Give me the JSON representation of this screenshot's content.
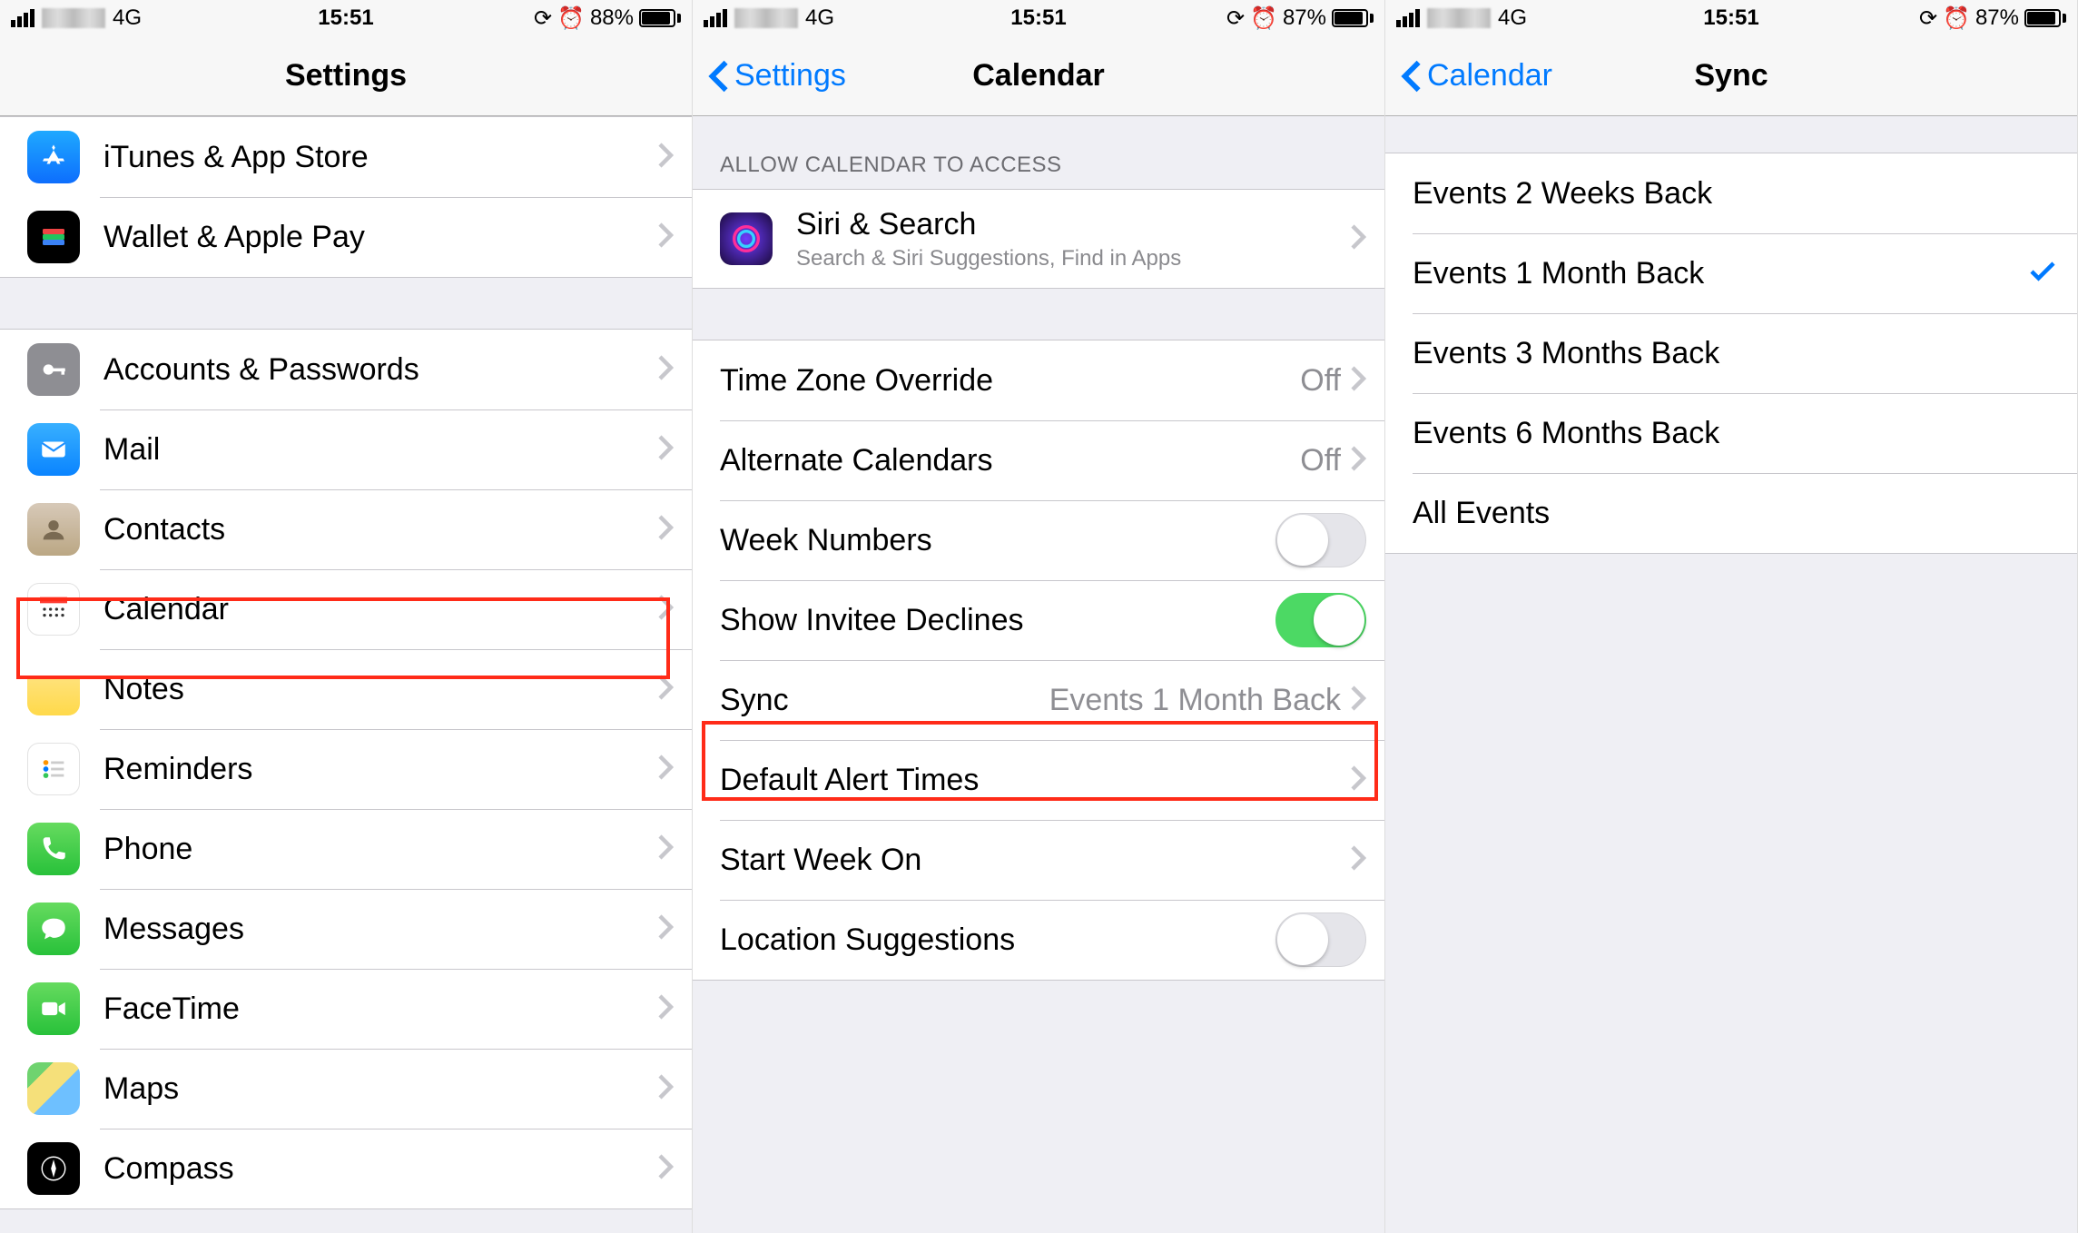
{
  "panes": {
    "left": {
      "status": {
        "network": "4G",
        "time": "15:51",
        "battery": "88%"
      },
      "nav": {
        "title": "Settings"
      },
      "group1": [
        {
          "icon": "appstore",
          "label": "iTunes & App Store"
        },
        {
          "icon": "wallet",
          "label": "Wallet & Apple Pay"
        }
      ],
      "group2": [
        {
          "icon": "accounts",
          "label": "Accounts & Passwords"
        },
        {
          "icon": "mail",
          "label": "Mail"
        },
        {
          "icon": "contacts",
          "label": "Contacts"
        },
        {
          "icon": "calendar",
          "label": "Calendar",
          "highlighted": true
        },
        {
          "icon": "notes",
          "label": "Notes"
        },
        {
          "icon": "reminders",
          "label": "Reminders"
        },
        {
          "icon": "phone",
          "label": "Phone"
        },
        {
          "icon": "messages",
          "label": "Messages"
        },
        {
          "icon": "facetime",
          "label": "FaceTime"
        },
        {
          "icon": "maps",
          "label": "Maps"
        },
        {
          "icon": "compass",
          "label": "Compass"
        }
      ]
    },
    "middle": {
      "status": {
        "network": "4G",
        "time": "15:51",
        "battery": "87%"
      },
      "nav": {
        "back": "Settings",
        "title": "Calendar"
      },
      "section_header": "ALLOW CALENDAR TO ACCESS",
      "siri": {
        "label": "Siri & Search",
        "sub": "Search & Siri Suggestions, Find in Apps"
      },
      "rows": {
        "timezone": {
          "label": "Time Zone Override",
          "value": "Off"
        },
        "altcal": {
          "label": "Alternate Calendars",
          "value": "Off"
        },
        "weeknum": {
          "label": "Week Numbers",
          "toggle": false
        },
        "declines": {
          "label": "Show Invitee Declines",
          "toggle": true
        },
        "sync": {
          "label": "Sync",
          "value": "Events 1 Month Back",
          "highlighted": true
        },
        "alerts": {
          "label": "Default Alert Times"
        },
        "startweek": {
          "label": "Start Week On"
        },
        "location": {
          "label": "Location Suggestions",
          "toggle": false
        }
      }
    },
    "right": {
      "status": {
        "network": "4G",
        "time": "15:51",
        "battery": "87%"
      },
      "nav": {
        "back": "Calendar",
        "title": "Sync"
      },
      "options": [
        {
          "label": "Events 2 Weeks Back",
          "checked": false
        },
        {
          "label": "Events 1 Month Back",
          "checked": true
        },
        {
          "label": "Events 3 Months Back",
          "checked": false
        },
        {
          "label": "Events 6 Months Back",
          "checked": false
        },
        {
          "label": "All Events",
          "checked": false
        }
      ]
    }
  }
}
